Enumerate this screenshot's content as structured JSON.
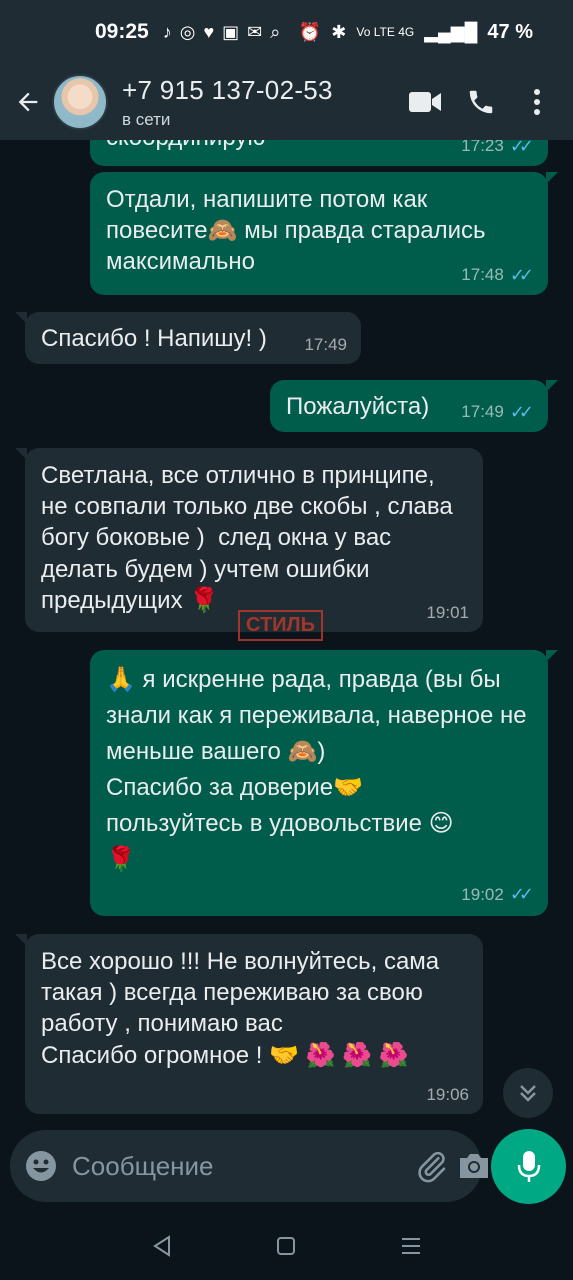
{
  "status_bar": {
    "time": "09:25",
    "network": "Vo LTE 4G",
    "battery": "47 %"
  },
  "header": {
    "contact_name": "+7 915 137-02-53",
    "contact_status": "в сети",
    "icons": [
      "back-arrow-icon",
      "video-call-icon",
      "phone-icon",
      "more-vert-icon"
    ]
  },
  "messages": [
    {
      "direction": "out",
      "text": "скоординирую",
      "time": "17:23",
      "read": true
    },
    {
      "direction": "out",
      "text": "Отдали, напишите потом как повесите🙈 мы правда старались максимально",
      "time": "17:48",
      "read": true
    },
    {
      "direction": "in",
      "text": "Спасибо ! Напишу! )",
      "time": "17:49"
    },
    {
      "direction": "out",
      "text": "Пожалуйста)",
      "time": "17:49",
      "read": true
    },
    {
      "direction": "in",
      "text": "Светлана, все отлично в принципе, не совпали только две скобы , слава богу боковые )  след окна у вас делать будем ) учтем ошибки предыдущих 🌹",
      "time": "19:01"
    },
    {
      "direction": "out",
      "text": "🙏 я искренне рада, правда (вы бы знали как я переживала, наверное не меньше вашего 🙈)\nСпасибо за доверие🤝\nпользуйтесь в удовольствие 😊\n🌹",
      "time": "19:02",
      "read": true
    },
    {
      "direction": "in",
      "text": "Все хорошо !!! Не волнуйтесь, сама такая ) всегда переживаю за свою работу , понимаю вас\nСпасибо огромное ! 🤝 🌺 🌺 🌺",
      "time": "19:06"
    }
  ],
  "watermark": "СТИЛЬ",
  "composer": {
    "placeholder": "Сообщение"
  },
  "colors": {
    "outgoing_bubble": "#005c4b",
    "incoming_bubble": "#202c33",
    "accent": "#00a884",
    "read_ticks": "#53bdeb",
    "background": "#0b141a"
  }
}
